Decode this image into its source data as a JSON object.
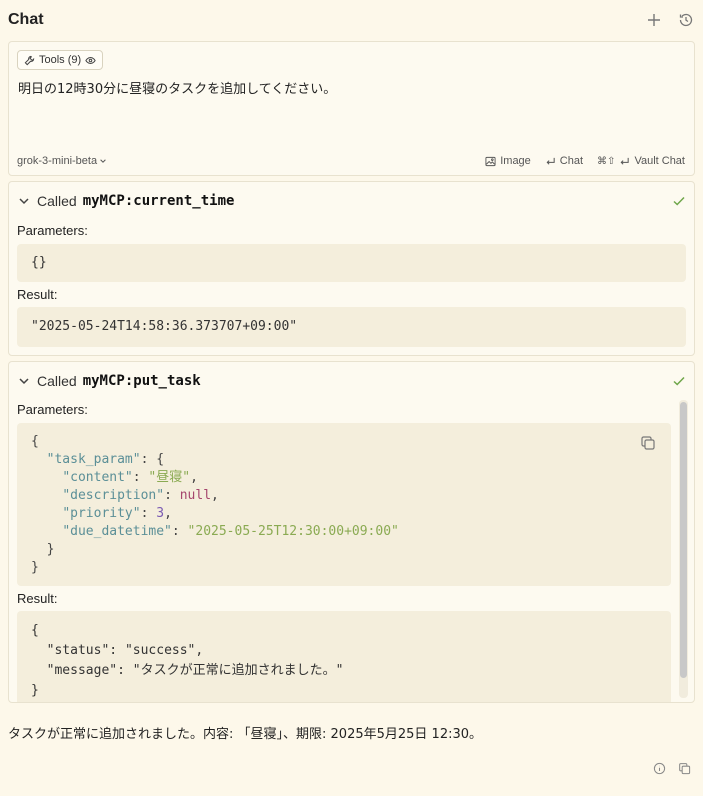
{
  "header": {
    "title": "Chat",
    "icons": [
      "plus-icon",
      "history-icon"
    ]
  },
  "composer": {
    "tools_label": "Tools (9)",
    "prompt": "明日の12時30分に昼寝のタスクを追加してください。",
    "model": "grok-3-mini-beta",
    "image_label": "Image",
    "chat_label": "Chat",
    "vault_chat_label": "Vault Chat"
  },
  "calls": [
    {
      "called_label": "Called",
      "function": "myMCP:current_time",
      "parameters_label": "Parameters:",
      "parameters": "{}",
      "result_label": "Result:",
      "result": "\"2025-05-24T14:58:36.373707+09:00\""
    },
    {
      "called_label": "Called",
      "function": "myMCP:put_task",
      "parameters_label": "Parameters:",
      "task_param_key": "\"task_param\"",
      "content_key": "\"content\"",
      "content_value": "\"昼寝\"",
      "description_key": "\"description\"",
      "description_value": "null",
      "priority_key": "\"priority\"",
      "priority_value": "3",
      "due_key": "\"due_datetime\"",
      "due_value": "\"2025-05-25T12:30:00+09:00\"",
      "result_label": "Result:",
      "status_key": "\"status\"",
      "status_value": "\"success\"",
      "message_key": "\"message\"",
      "message_value": "\"タスクが正常に追加されました。\""
    }
  ],
  "answer": "タスクが正常に追加されました。内容: 「昼寝」、期限: 2025年5月25日 12:30。",
  "colors": {
    "background": "#fdf8ea",
    "code_bg": "#f4eedc",
    "check": "#6fa64a"
  }
}
